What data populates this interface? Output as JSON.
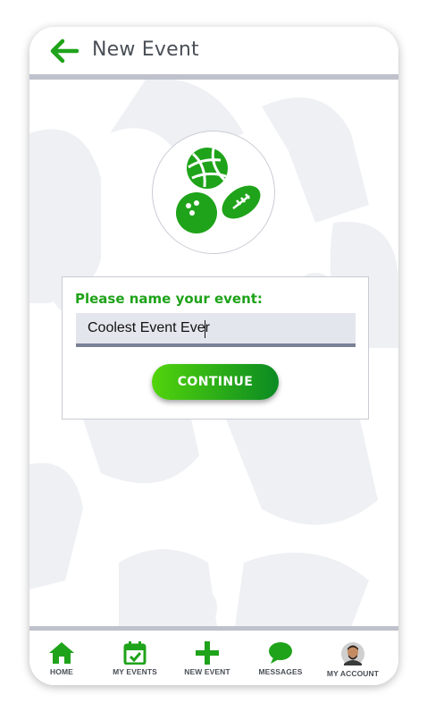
{
  "header": {
    "title": "New Event",
    "back_icon": "back-arrow-icon"
  },
  "illustration": {
    "icons": [
      "volleyball-icon",
      "bowling-ball-icon",
      "football-icon"
    ]
  },
  "form": {
    "prompt": "Please name your event:",
    "input_value": "Coolest Event Ever",
    "continue_label": "CONTINUE"
  },
  "nav": {
    "items": [
      {
        "label": "HOME",
        "icon": "home-icon"
      },
      {
        "label": "MY EVENTS",
        "icon": "calendar-check-icon"
      },
      {
        "label": "NEW EVENT",
        "icon": "plus-icon"
      },
      {
        "label": "MESSAGES",
        "icon": "chat-bubble-icon"
      },
      {
        "label": "MY ACCOUNT",
        "icon": "avatar-icon"
      }
    ]
  },
  "colors": {
    "brand_green": "#1fa31a",
    "button_gradient_start": "#52d40c",
    "button_gradient_end": "#0a8a22",
    "title_gray": "#4a4f57",
    "rule_gray": "#bfc2cc"
  }
}
